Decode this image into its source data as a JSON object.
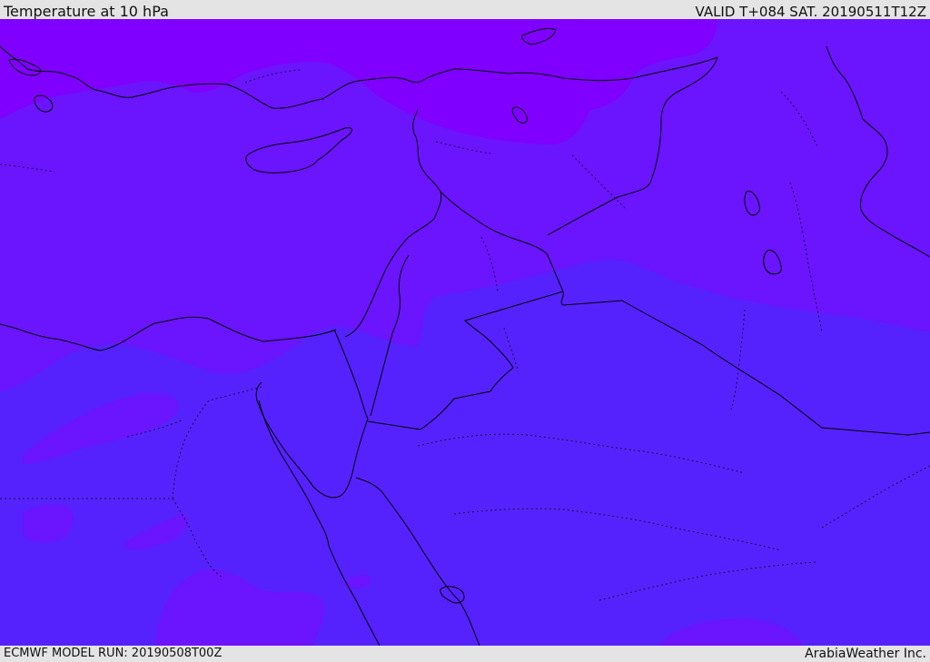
{
  "header": {
    "title": "Temperature at 10 hPa",
    "valid_time": "VALID T+084 SAT. 20190511T12Z"
  },
  "footer": {
    "model_run": "ECMWF MODEL RUN: 20190508T00Z",
    "provider": "ArabiaWeather Inc."
  },
  "map": {
    "colors": {
      "warm_band": "#7f00fe",
      "mid_band": "#6b14fe",
      "cool_band": "#5522fe",
      "coastline": "#000000",
      "border_dotted": "#1a0f40"
    }
  }
}
